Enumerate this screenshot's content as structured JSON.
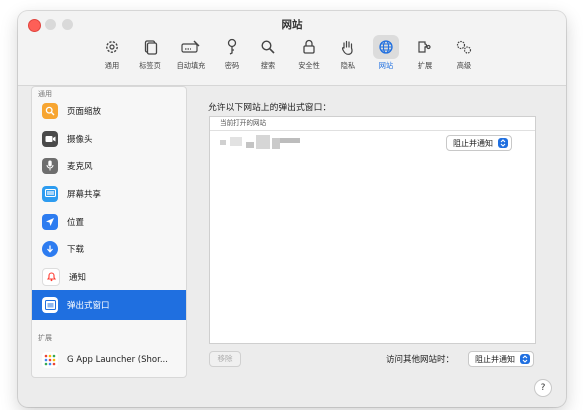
{
  "window": {
    "title": "网站"
  },
  "toolbar": {
    "items": [
      {
        "label": "通用",
        "icon": "gear-icon"
      },
      {
        "label": "标签页",
        "icon": "tabs-icon"
      },
      {
        "label": "自动填充",
        "icon": "autofill-icon"
      },
      {
        "label": "密码",
        "icon": "key-icon"
      },
      {
        "label": "搜索",
        "icon": "search-icon"
      },
      {
        "label": "安全性",
        "icon": "lock-icon"
      },
      {
        "label": "隐私",
        "icon": "hand-icon"
      },
      {
        "label": "网站",
        "icon": "globe-icon"
      },
      {
        "label": "扩展",
        "icon": "puzzle-icon"
      },
      {
        "label": "高级",
        "icon": "gears-icon"
      }
    ],
    "active": "网站"
  },
  "sidebar": {
    "section_general": "通用",
    "items": [
      {
        "label": "页面缩放",
        "icon": "zoom-icon",
        "color": "#f7a531"
      },
      {
        "label": "摄像头",
        "icon": "camera-icon",
        "color": "#4a4a4a"
      },
      {
        "label": "麦克风",
        "icon": "microphone-icon",
        "color": "#6e6e6e"
      },
      {
        "label": "屏幕共享",
        "icon": "screen-share-icon",
        "color": "#2d9cf0"
      },
      {
        "label": "位置",
        "icon": "location-icon",
        "color": "#2d7cf0"
      },
      {
        "label": "下载",
        "icon": "download-icon",
        "color": "#2d7cf0"
      },
      {
        "label": "通知",
        "icon": "bell-icon",
        "color": "#ff3b30"
      },
      {
        "label": "弹出式窗口",
        "icon": "popup-window-icon",
        "color": "#ffffff"
      }
    ],
    "selected": "弹出式窗口",
    "section_extensions": "扩展",
    "extension_item": "G App Launcher (Shor..."
  },
  "main": {
    "heading": "允许以下网站上的弹出式窗口：",
    "table_header": "当前打开的网站",
    "row_setting": "阻止并通知",
    "remove_label": "移除",
    "other_sites_label": "访问其他网站时：",
    "other_sites_setting": "阻止并通知",
    "help_label": "?"
  },
  "colors": {
    "accent": "#1f6fe0",
    "close": "#fe5f57"
  }
}
